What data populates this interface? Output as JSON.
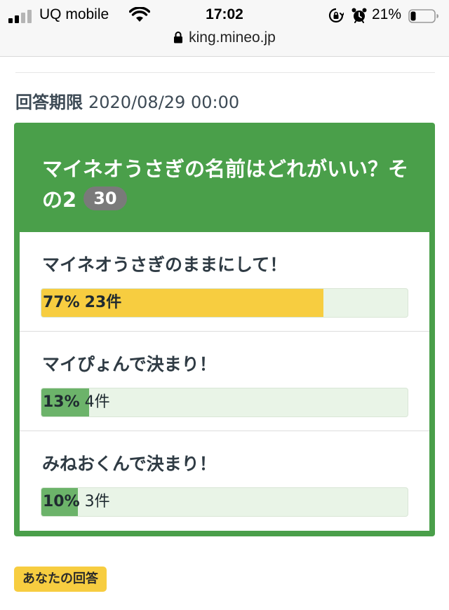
{
  "status_bar": {
    "carrier": "UQ mobile",
    "time": "17:02",
    "battery_percent": "21%",
    "url": "king.mineo.jp",
    "icons": [
      "signal-icon",
      "wifi-icon",
      "orientation-lock-icon",
      "alarm-icon",
      "battery-icon",
      "padlock-icon"
    ]
  },
  "deadline": {
    "label": "回答期限",
    "value": "2020/08/29 00:00"
  },
  "poll": {
    "title": "マイネオうさぎの名前はどれがいい？その2",
    "vote_count": "30",
    "colors": {
      "header": "#4a9f4a",
      "winner_bar": "#f7cd40",
      "bar": "#6cb36a",
      "track": "#e9f4e7",
      "badge": "#7a7a7a"
    },
    "options": [
      {
        "label": "マイネオうさぎのままにして！",
        "percent_text": "77%",
        "count_text": "23件",
        "share": 0.77,
        "winner": true
      },
      {
        "label": "マイぴょんで決まり！",
        "percent_text": "13%",
        "count_text": "4件",
        "share": 0.13,
        "winner": false
      },
      {
        "label": "みねおくんで決まり！",
        "percent_text": "10%",
        "count_text": "3件",
        "share": 0.1,
        "winner": false
      }
    ]
  },
  "your_answer_label": "あなたの回答"
}
